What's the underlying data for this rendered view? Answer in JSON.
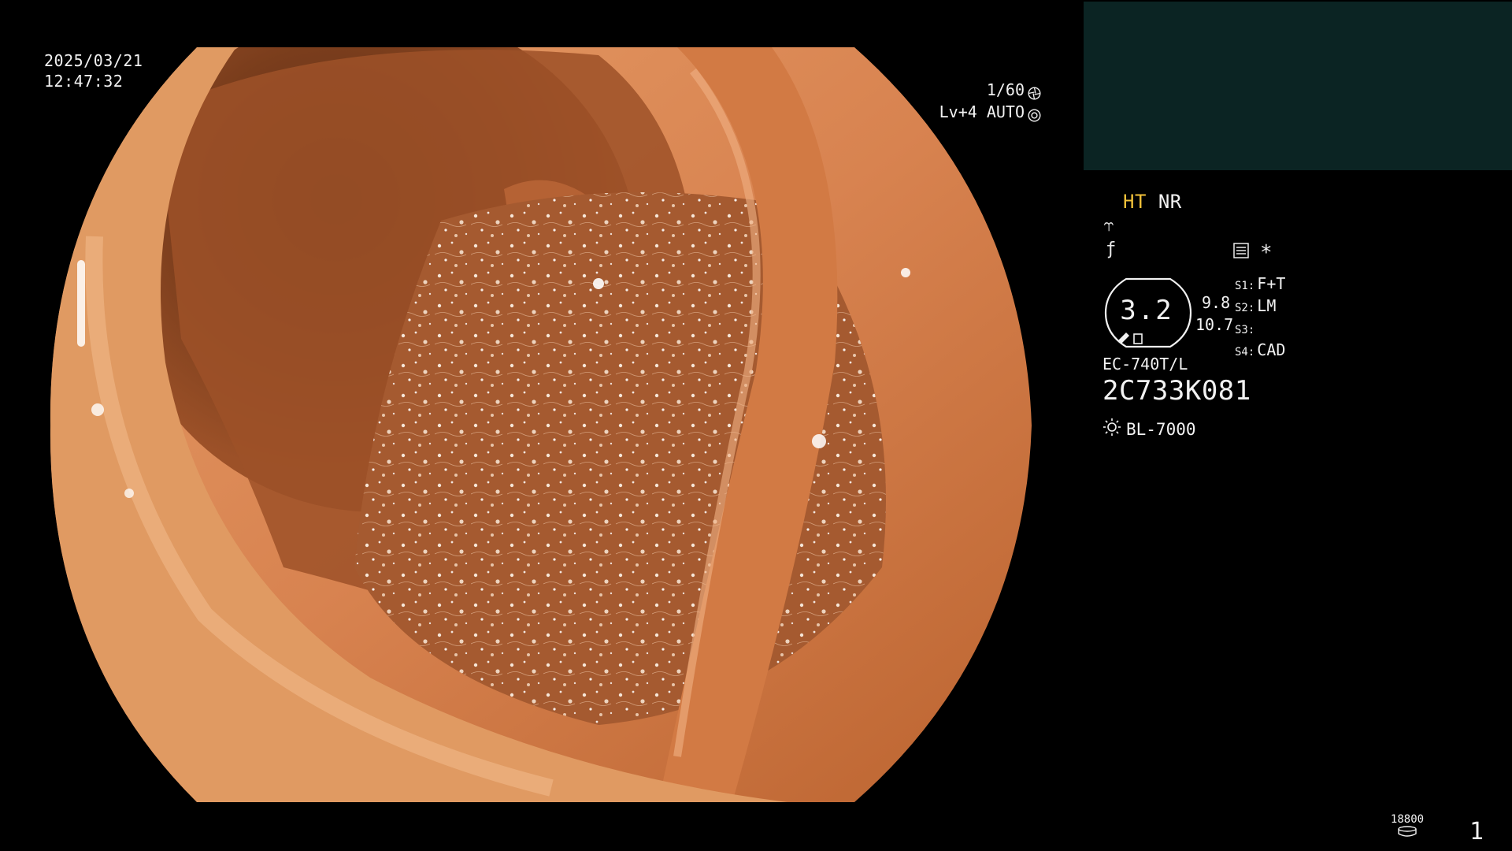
{
  "overlay": {
    "date": "2025/03/21",
    "time": "12:47:32",
    "shutter": "1/60",
    "shutter_icon": "aperture-icon",
    "level": "Lv+4 AUTO",
    "level_icon": "iris-icon"
  },
  "side_panel": {
    "ht_label": "HT",
    "nr_label": "NR",
    "ht_color": "#f2c23a",
    "enhance_glyph": "⥾",
    "gamma_glyph": "ƒ",
    "menu_icon": "settings-list-icon",
    "star_glyph": "*",
    "gauge_value": "3.2",
    "gauge_sub_1": "9.8",
    "gauge_sub_2": "10.7",
    "switches": [
      {
        "key": "S1:",
        "value": "F+T"
      },
      {
        "key": "S2:",
        "value": "LM"
      },
      {
        "key": "S3:",
        "value": ""
      },
      {
        "key": "S4:",
        "value": "CAD"
      }
    ],
    "scope_model": "EC-740T/L",
    "scope_serial": "2C733K081",
    "light_icon": "sun-icon",
    "light_source": "BL-7000"
  },
  "footer": {
    "frame_count": "18800",
    "storage_icon": "disk-icon",
    "page_number": "1"
  },
  "colors": {
    "background": "#000000",
    "sub_monitor": "#0b2423",
    "mucosa": "#c8703e"
  }
}
